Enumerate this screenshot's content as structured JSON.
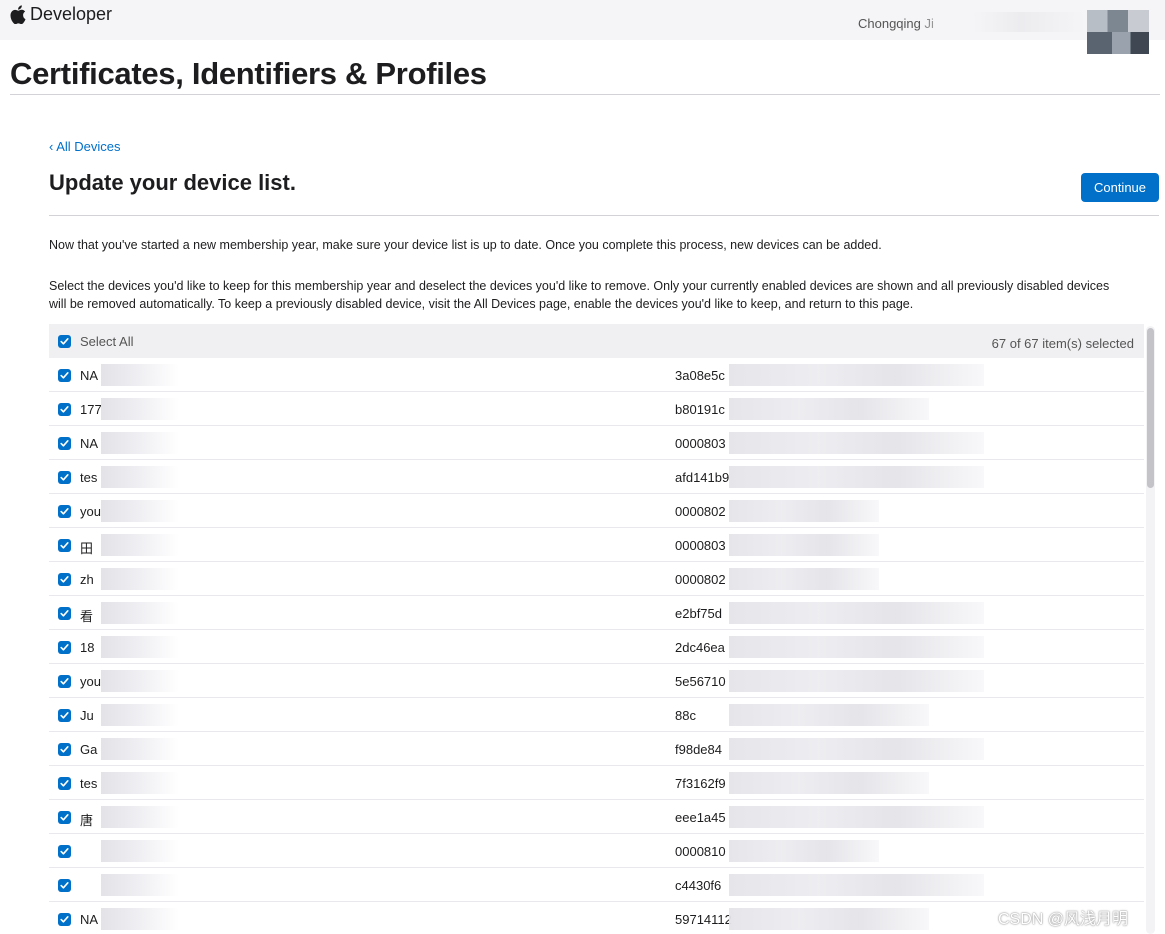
{
  "header": {
    "brand_label": "Developer",
    "logo_icon": "apple-icon",
    "account_name": "Chongqing Ji"
  },
  "page": {
    "title": "Certificates, Identifiers & Profiles",
    "back_link": "‹ All Devices",
    "section_title": "Update your device list.",
    "continue_label": "Continue",
    "intro_text": "Now that you've started a new membership year, make sure your device list is up to date. Once you complete this process, new devices can be added.",
    "instructions_text": "Select the devices you'd like to keep for this membership year and deselect the devices you'd like to remove. Only your currently enabled devices are shown and all previously disabled devices will be removed automatically. To keep a previously disabled device, visit the All Devices page, enable the devices you'd like to keep, and return to this page."
  },
  "table": {
    "select_all_label": "Select All",
    "selected_count": "67 of 67 item(s) selected",
    "rows": [
      {
        "name": "NA",
        "udid": "3a08e5c"
      },
      {
        "name": "177",
        "udid": "b80191c"
      },
      {
        "name": "NA",
        "udid": "0000803"
      },
      {
        "name": "tes",
        "udid": "afd141b9"
      },
      {
        "name": "you",
        "udid": "0000802"
      },
      {
        "name": "田",
        "udid": "0000803"
      },
      {
        "name": "zh",
        "udid": "0000802"
      },
      {
        "name": "看",
        "udid": "e2bf75d"
      },
      {
        "name": "18",
        "udid": "2dc46ea"
      },
      {
        "name": "you",
        "udid": "5e56710"
      },
      {
        "name": "Ju",
        "udid": "88c"
      },
      {
        "name": "Ga",
        "udid": "f98de84"
      },
      {
        "name": "tes",
        "udid": "7f3162f9"
      },
      {
        "name": "唐",
        "udid": "eee1a45"
      },
      {
        "name": "",
        "udid": "0000810"
      },
      {
        "name": "",
        "udid": "c4430f6"
      },
      {
        "name": "NA",
        "udid": "59714112"
      }
    ]
  },
  "watermark": "CSDN @风浅月明"
}
